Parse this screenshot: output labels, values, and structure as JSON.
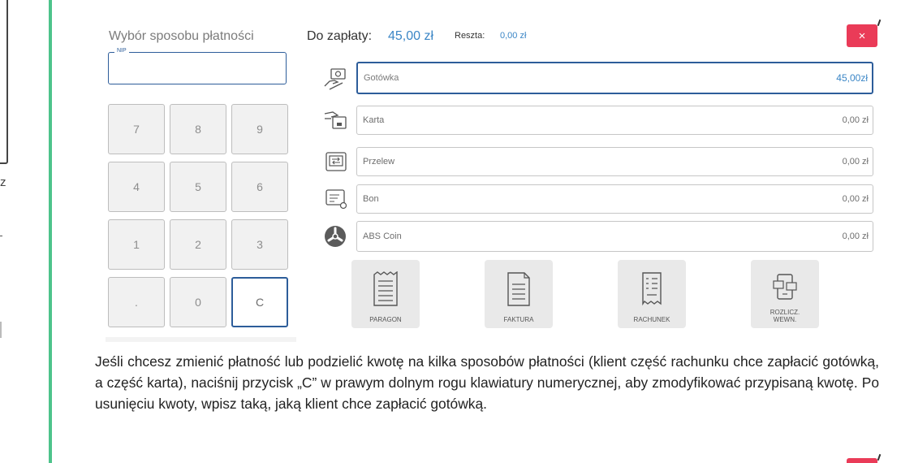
{
  "background": {
    "left_fragment_char": "z",
    "accent_line_color": "#4dc38b"
  },
  "payment": {
    "title": "Wybór sposobu płatności",
    "nip_label": "NIP",
    "nip_value": "",
    "due_label": "Do zapłaty:",
    "due_value": "45,00 zł",
    "change_label": "Reszta:",
    "change_value": "0,00 zł",
    "close_symbol": "×",
    "keypad": [
      "7",
      "8",
      "9",
      "4",
      "5",
      "6",
      "1",
      "2",
      "3",
      ".",
      "0",
      "C"
    ],
    "methods": [
      {
        "label": "Gotówka",
        "amount": "45,00zł",
        "icon": "cash-hand-icon",
        "active": true
      },
      {
        "label": "Karta",
        "amount": "0,00 zł",
        "icon": "card-hand-icon"
      },
      {
        "label": "Przelew",
        "amount": "0,00 zł",
        "icon": "transfer-icon"
      },
      {
        "label": "Bon",
        "amount": "0,00 zł",
        "icon": "voucher-icon"
      },
      {
        "label": "ABS Coin",
        "amount": "0,00 zł",
        "icon": "abs-coin-icon"
      }
    ],
    "documents": [
      {
        "label": "PARAGON",
        "icon": "receipt-icon"
      },
      {
        "label": "FAKTURA",
        "icon": "invoice-icon"
      },
      {
        "label": "RACHUNEK",
        "icon": "bill-icon"
      },
      {
        "label": "ROZLICZ.\nWEWN.",
        "icon": "internal-settlement-icon"
      }
    ],
    "colors": {
      "accent_blue": "#3b86c6",
      "active_border": "#2d5d9a",
      "close_red": "#ea3b58"
    }
  },
  "description": "Jeśli chcesz zmienić płatność lub podzielić kwotę na kilka sposobów płatności (klient część rachunku chce zapłacić gotówką, a część karta), naciśnij przycisk „C” w prawym dolnym rogu klawiatury numerycznej, aby zmodyfikować przypisaną kwotę. Po usunięciu kwoty, wpisz taką, jaką klient chce zapłacić gotówką."
}
